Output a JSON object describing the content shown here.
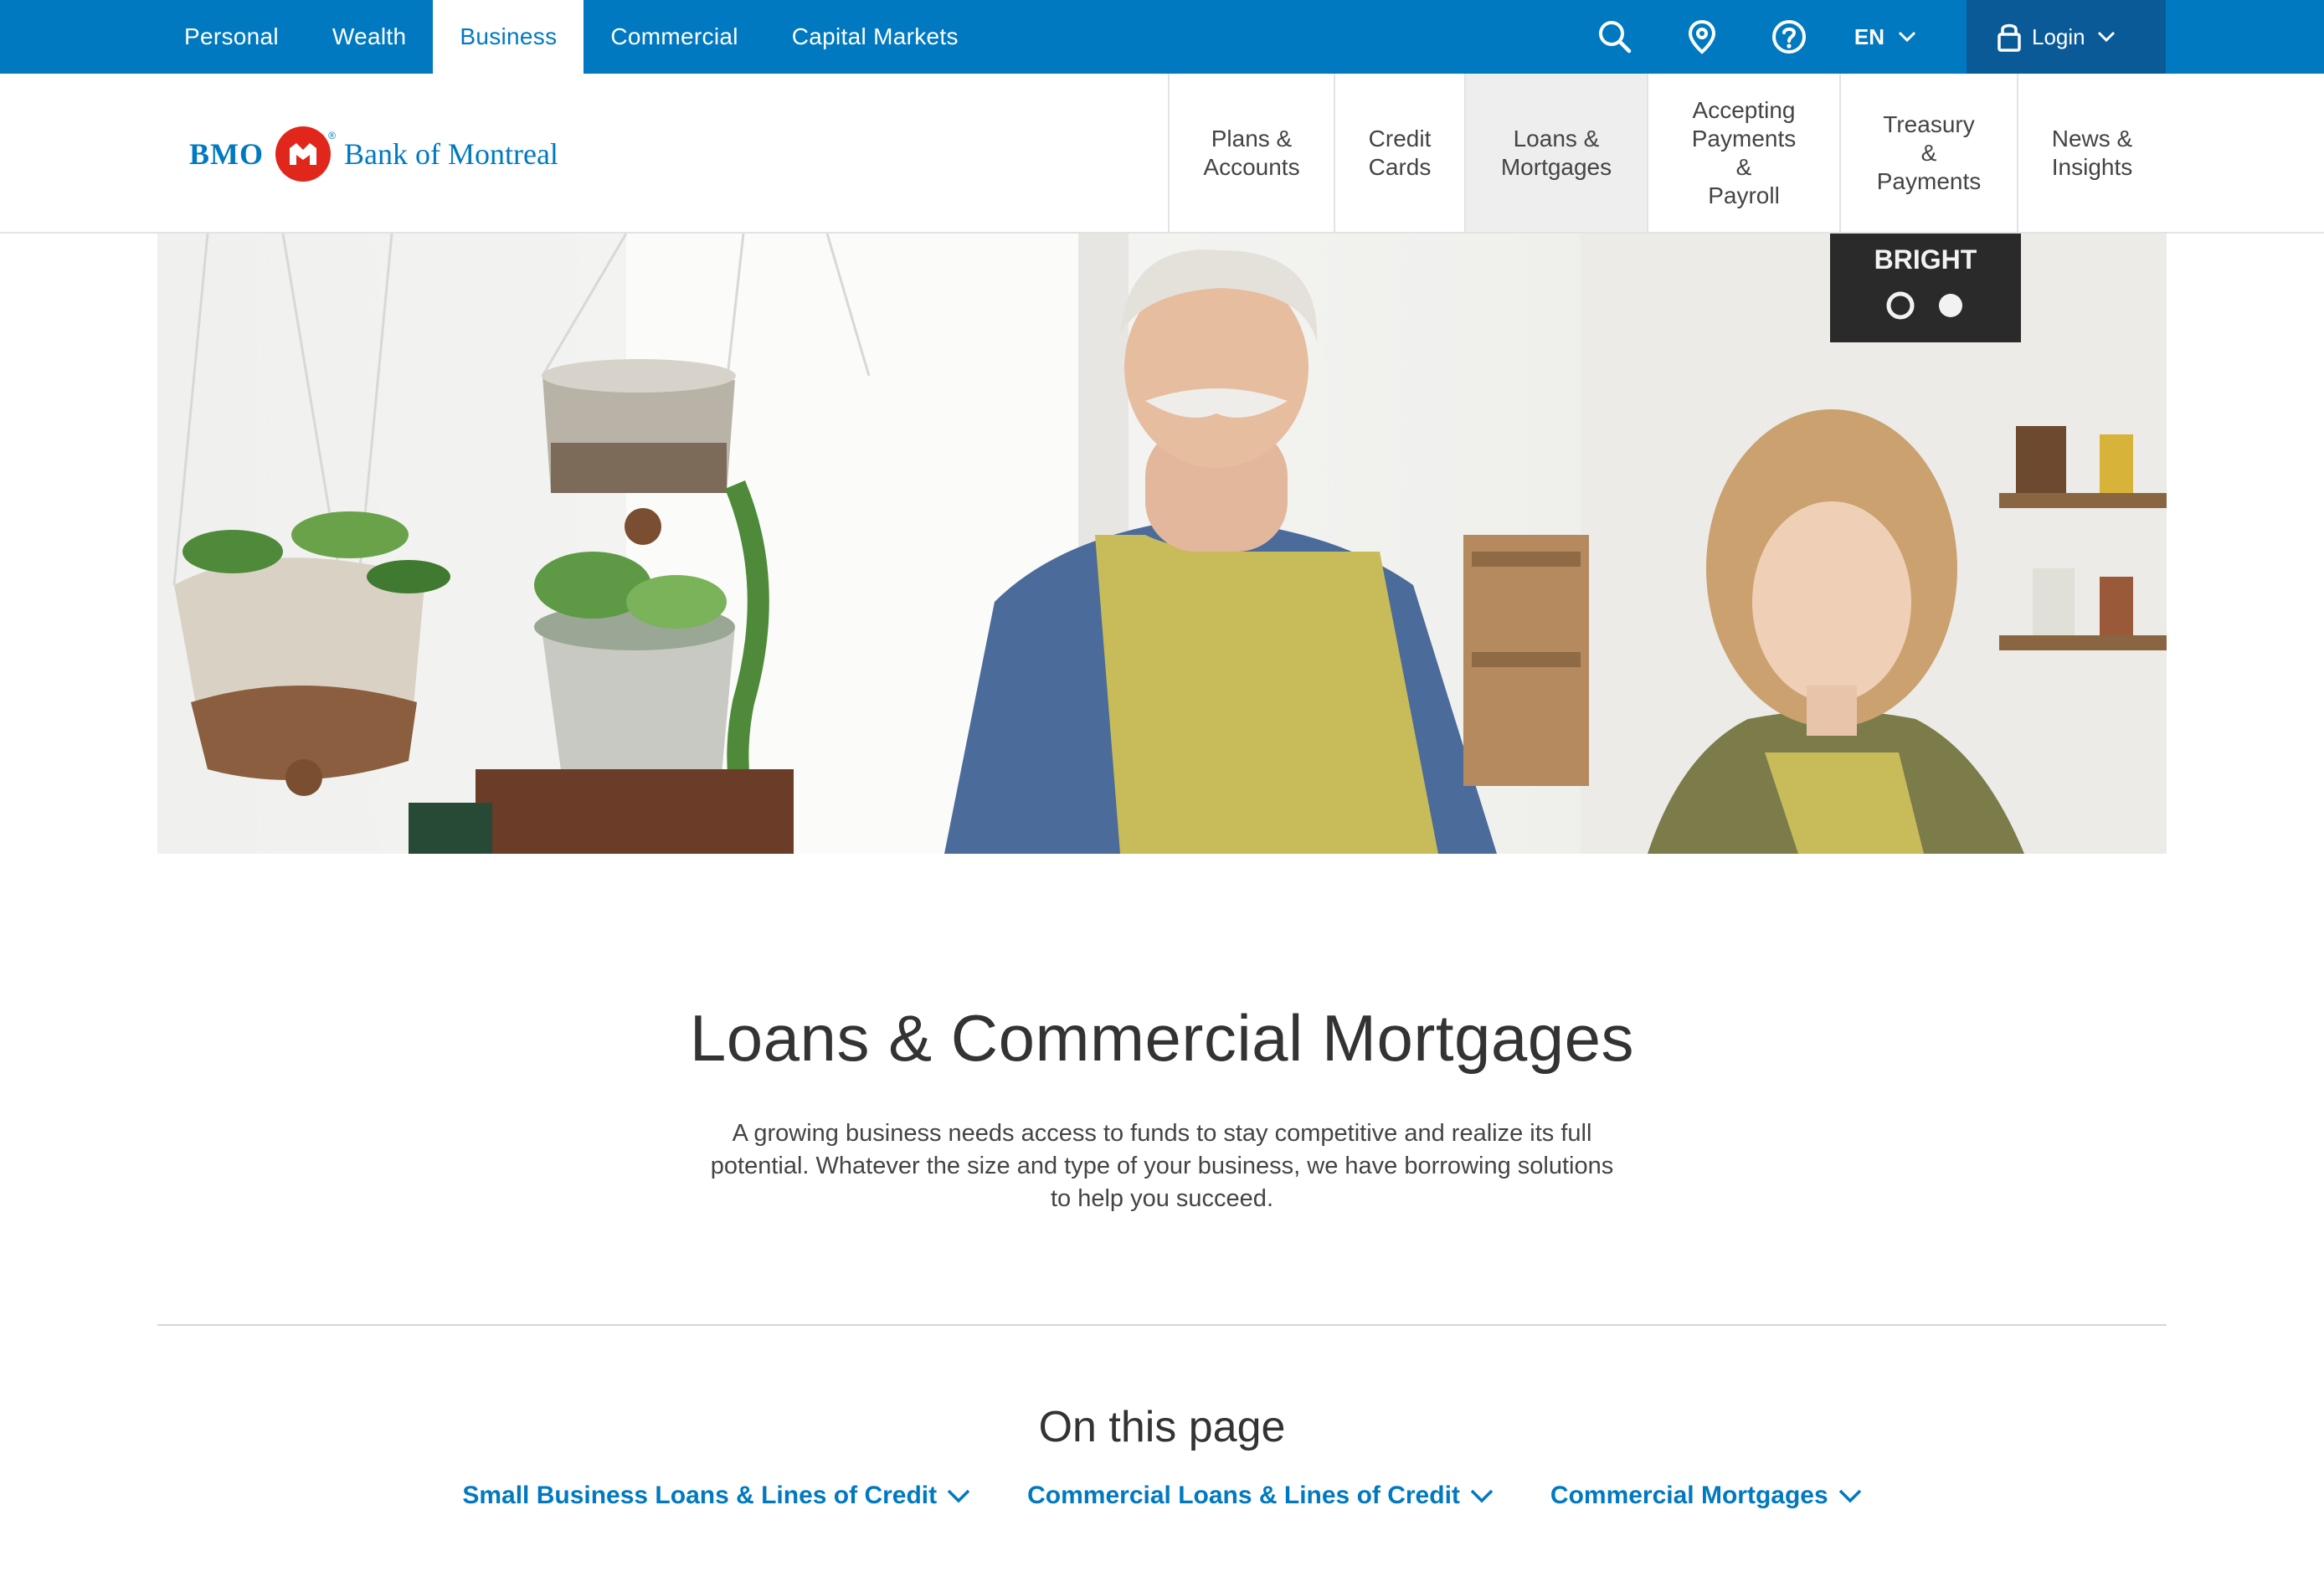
{
  "topnav": {
    "tabs": [
      {
        "label": "Personal"
      },
      {
        "label": "Wealth"
      },
      {
        "label": "Business"
      },
      {
        "label": "Commercial"
      },
      {
        "label": "Capital Markets"
      }
    ],
    "active_tab": "Business"
  },
  "utilities": {
    "search_icon": "search-icon",
    "location_icon": "location-pin-icon",
    "help_icon": "question-circle-icon",
    "language": "EN",
    "login_label": "Login"
  },
  "logo": {
    "bmo": "BMO",
    "bank_name": "Bank of Montreal"
  },
  "mainnav": {
    "items": [
      {
        "label": "Plans &\nAccounts"
      },
      {
        "label": "Credit\nCards"
      },
      {
        "label": "Loans &\nMortgages"
      },
      {
        "label": "Accepting\nPayments &\nPayroll"
      },
      {
        "label": "Treasury &\nPayments"
      },
      {
        "label": "News &\nInsights"
      }
    ],
    "active_item": "Loans & Mortgages"
  },
  "hero": {
    "sign_text": "BRIGHT"
  },
  "page": {
    "title": "Loans & Commercial Mortgages",
    "intro": "A growing business needs access to funds to stay competitive and realize its full potential. Whatever the size and type of your business, we have borrowing solutions to help you succeed.",
    "on_this_page": "On this page",
    "anchors": [
      {
        "label": "Small Business Loans & Lines of Credit"
      },
      {
        "label": "Commercial Loans & Lines of Credit"
      },
      {
        "label": "Commercial Mortgages"
      }
    ]
  },
  "colors": {
    "brand_blue": "#0079c1",
    "login_bg": "#0b5a98",
    "brand_red": "#e1261c",
    "active_nav_bg": "#eeeeee"
  }
}
